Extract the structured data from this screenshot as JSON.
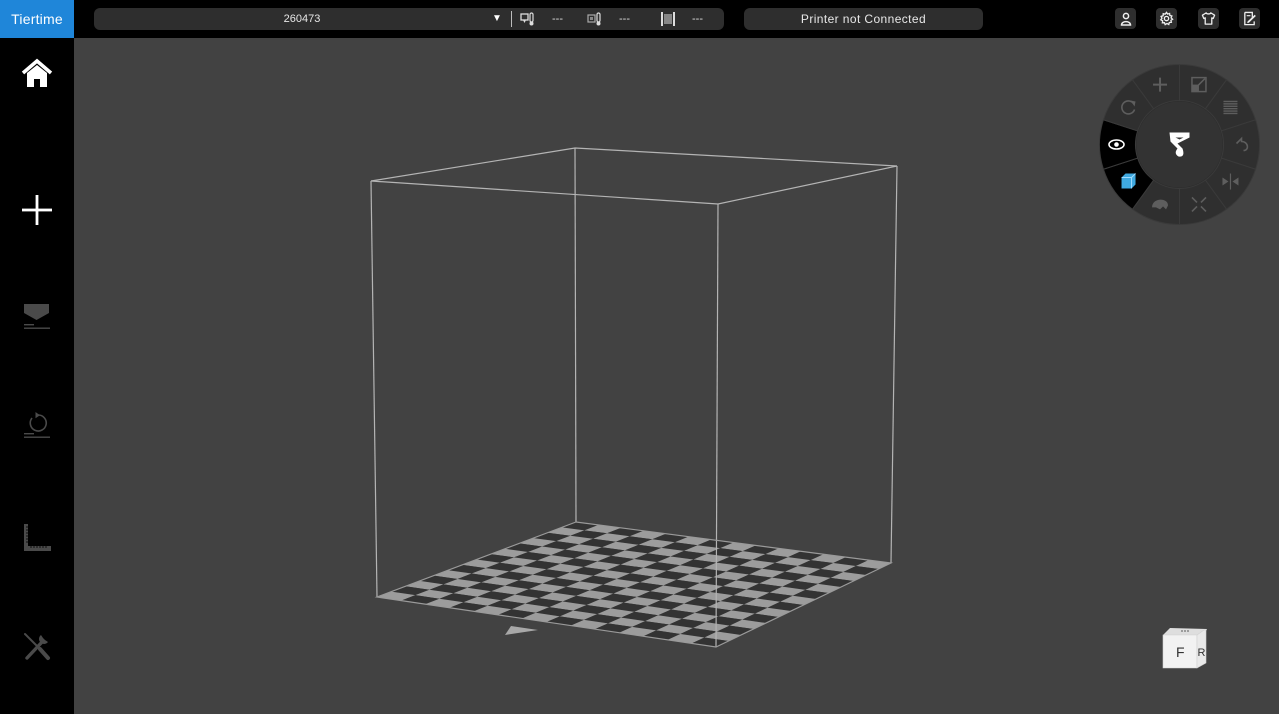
{
  "app": {
    "logo": "Tiertime"
  },
  "topbar": {
    "model_selector": {
      "value": "260473",
      "dropdown_icon": "triangle-down-icon"
    },
    "stats": [
      {
        "name": "nozzle-temperature",
        "icon": "nozzle-thermometer-icon",
        "value": "---"
      },
      {
        "name": "platform-temperature",
        "icon": "platform-thermometer-icon",
        "value": "---"
      },
      {
        "name": "filament",
        "icon": "filament-spool-icon",
        "value": "---"
      }
    ],
    "printer_status": "Printer not Connected",
    "buttons": [
      {
        "name": "account-button",
        "icon": "user-icon"
      },
      {
        "name": "settings-button",
        "icon": "gear-icon"
      },
      {
        "name": "appearance-button",
        "icon": "shirt-icon"
      },
      {
        "name": "notes-button",
        "icon": "document-edit-icon"
      }
    ]
  },
  "sidebar": {
    "items": [
      {
        "name": "home",
        "icon": "home-icon",
        "enabled": true
      },
      {
        "name": "add-model",
        "icon": "plus-icon",
        "enabled": true
      },
      {
        "name": "print",
        "icon": "print-download-icon",
        "enabled": false
      },
      {
        "name": "initialize",
        "icon": "reset-rotate-icon",
        "enabled": false
      },
      {
        "name": "calibrate",
        "icon": "ruler-square-icon",
        "enabled": false
      },
      {
        "name": "maintenance",
        "icon": "tools-icon",
        "enabled": false
      }
    ]
  },
  "radial_menu": {
    "center_icon": "tiertime-brand-icon",
    "segments": [
      {
        "name": "add",
        "icon": "plus-icon",
        "active": false
      },
      {
        "name": "scale",
        "icon": "scale-icon",
        "active": false
      },
      {
        "name": "layers",
        "icon": "layers-icon",
        "active": false
      },
      {
        "name": "undo",
        "icon": "undo-icon",
        "active": false
      },
      {
        "name": "mirror",
        "icon": "mirror-icon",
        "active": false
      },
      {
        "name": "auto-place",
        "icon": "shrink-arrows-icon",
        "active": false
      },
      {
        "name": "support",
        "icon": "support-icon",
        "active": false
      },
      {
        "name": "view-cube-mode",
        "icon": "cube-icon",
        "active": true
      },
      {
        "name": "view",
        "icon": "eye-icon",
        "active": true
      },
      {
        "name": "rotate",
        "icon": "rotate-icon",
        "active": false
      }
    ],
    "active_color": "#3fa9e0"
  },
  "view_cube": {
    "front_label": "F",
    "right_label": "R"
  },
  "colors": {
    "brand": "#1f86d9",
    "viewport_bg": "#424242",
    "toolbar_bg": "#000000"
  }
}
